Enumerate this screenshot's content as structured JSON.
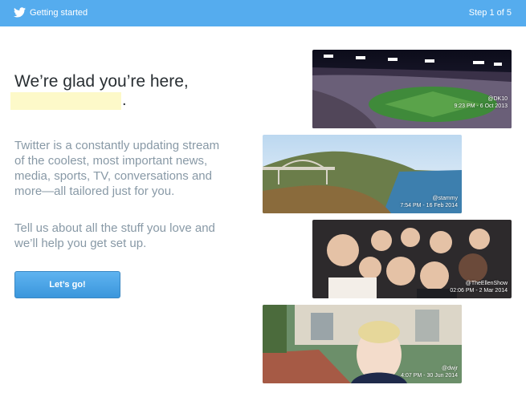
{
  "header": {
    "app_icon": "bird-icon",
    "title": "Getting started",
    "step": "Step 1 of 5",
    "bar_color": "#55acee"
  },
  "main": {
    "headline": "We’re glad you’re here,",
    "period": ".",
    "paragraph1": "Twitter is a constantly updating stream of the coolest, most important news, media, sports, TV, conversations and more—all tailored just for you.",
    "paragraph2": "Tell us about all the stuff you love and we’ll help you get set up.",
    "cta_label": "Let’s go!"
  },
  "photos": [
    {
      "handle": "@DK10",
      "caption": "9:23 PM - 6 Oct 2013"
    },
    {
      "handle": "@stammy",
      "caption": "7:54 PM - 16 Feb 2014"
    },
    {
      "handle": "@TheEllenShow",
      "caption": "02:06 PM - 2 Mar 2014"
    },
    {
      "handle": "@dwjr",
      "caption": "4:07 PM - 30 Jun 2014"
    }
  ]
}
